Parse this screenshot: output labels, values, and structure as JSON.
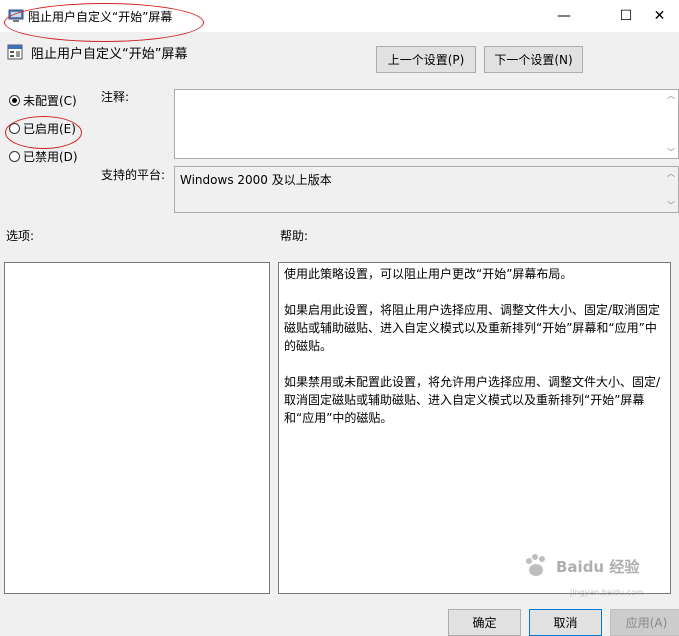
{
  "window": {
    "title": "阻止用户自定义“开始”屏幕",
    "minimize_glyph": "—",
    "maximize_glyph": "☐",
    "close_glyph": "✕"
  },
  "header": {
    "setting_title": "阻止用户自定义“开始”屏幕",
    "prev_button": "上一个设置(P)",
    "next_button": "下一个设置(N)"
  },
  "options": {
    "radios": [
      {
        "label": "未配置(C)",
        "checked": true
      },
      {
        "label": "已启用(E)",
        "checked": false
      },
      {
        "label": "已禁用(D)",
        "checked": false
      }
    ]
  },
  "comment": {
    "label": "注释:",
    "value": ""
  },
  "platform": {
    "label": "支持的平台:",
    "value": "Windows 2000 及以上版本"
  },
  "sections": {
    "options_label": "选项:",
    "help_label": "帮助:"
  },
  "help": {
    "paragraphs": [
      "使用此策略设置，可以阻止用户更改“开始”屏幕布局。",
      "如果启用此设置，将阻止用户选择应用、调整文件大小、固定/取消固定磁贴或辅助磁贴、进入自定义模式以及重新排列“开始”屏幕和“应用”中的磁贴。",
      "如果禁用或未配置此设置，将允许用户选择应用、调整文件大小、固定/取消固定磁贴或辅助磁贴、进入自定义模式以及重新排列“开始”屏幕和“应用”中的磁贴。"
    ]
  },
  "footer": {
    "ok_button": "确定",
    "cancel_button": "取消",
    "apply_button": "应用(A)"
  },
  "watermark": {
    "text": "Baidu 经验",
    "sub": "jingyan.baidu.com"
  },
  "colors": {
    "annotation": "#d02020",
    "window_bg": "#f0f0f0",
    "accent_border": "#0078d7"
  }
}
